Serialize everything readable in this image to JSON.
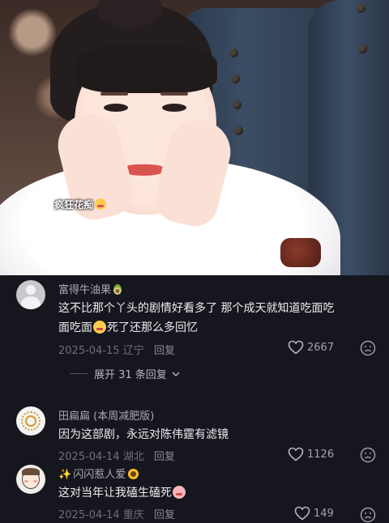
{
  "video": {
    "sticker_text": "疯狂花痴",
    "sticker_emoji": "heart-eyes-face"
  },
  "comments": [
    {
      "username": "富得牛油果",
      "username_emoji": "avocado",
      "text_line1": "这不比那个丫头的剧情好看多了 那个成天就知道吃面吃",
      "text_line2_a": "面吃面",
      "text_line2_emoji": "crying-face",
      "text_line2_b": "死了还那么多回忆",
      "date": "2025-04-15",
      "location": "辽宁",
      "reply_label": "回复",
      "likes": "2667"
    },
    {
      "username": "田扁扁 (本周减肥版)",
      "text_line1": "因为这部剧，永远对陈伟霆有滤镜",
      "date": "2025-04-14",
      "location": "湖北",
      "reply_label": "回复",
      "likes": "1126"
    },
    {
      "username_prefix": "✨",
      "username": "闪闪惹人爱",
      "username_emoji": "sunflower",
      "text_line1": "这对当年让我磕生磕死",
      "text_emoji": "pig-face",
      "date": "2025-04-14",
      "location": "重庆",
      "reply_label": "回复",
      "likes": "149"
    }
  ],
  "expand_replies": "展开 31 条回复",
  "colors": {
    "background": "#16161e",
    "text": "#ececf0",
    "muted": "#6f6f79"
  }
}
